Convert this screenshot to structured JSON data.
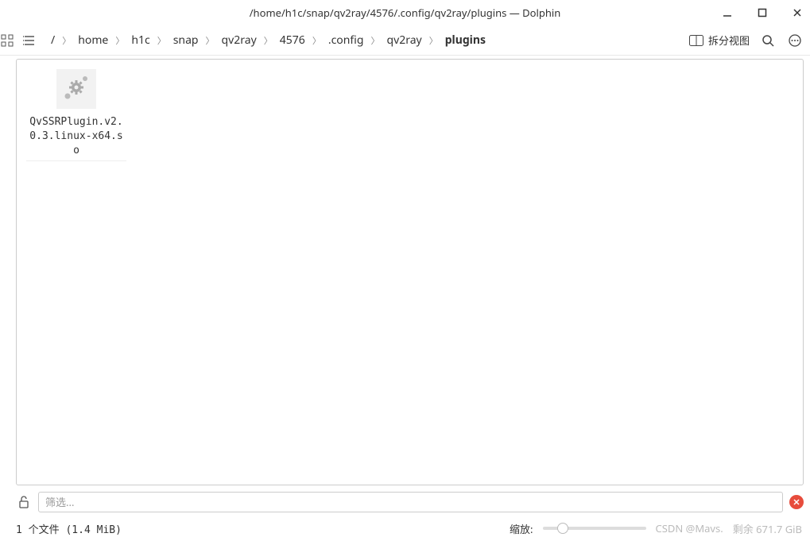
{
  "window": {
    "title": "/home/h1c/snap/qv2ray/4576/.config/qv2ray/plugins — Dolphin"
  },
  "breadcrumb": {
    "root": "/",
    "segments": [
      "home",
      "h1c",
      "snap",
      "qv2ray",
      "4576",
      ".config",
      "qv2ray"
    ],
    "current": "plugins"
  },
  "toolbar": {
    "split_view_label": "拆分视图"
  },
  "files": [
    {
      "name": "QvSSRPlugin.v2.0.3.linux-x64.so"
    }
  ],
  "filter": {
    "placeholder": "筛选..."
  },
  "status": {
    "file_count_text": "1 个文件 (1.4 MiB)",
    "zoom_label": "缩放:",
    "disk_remaining": "剩余 671.7 GiB",
    "watermark": "CSDN @Mavs."
  }
}
